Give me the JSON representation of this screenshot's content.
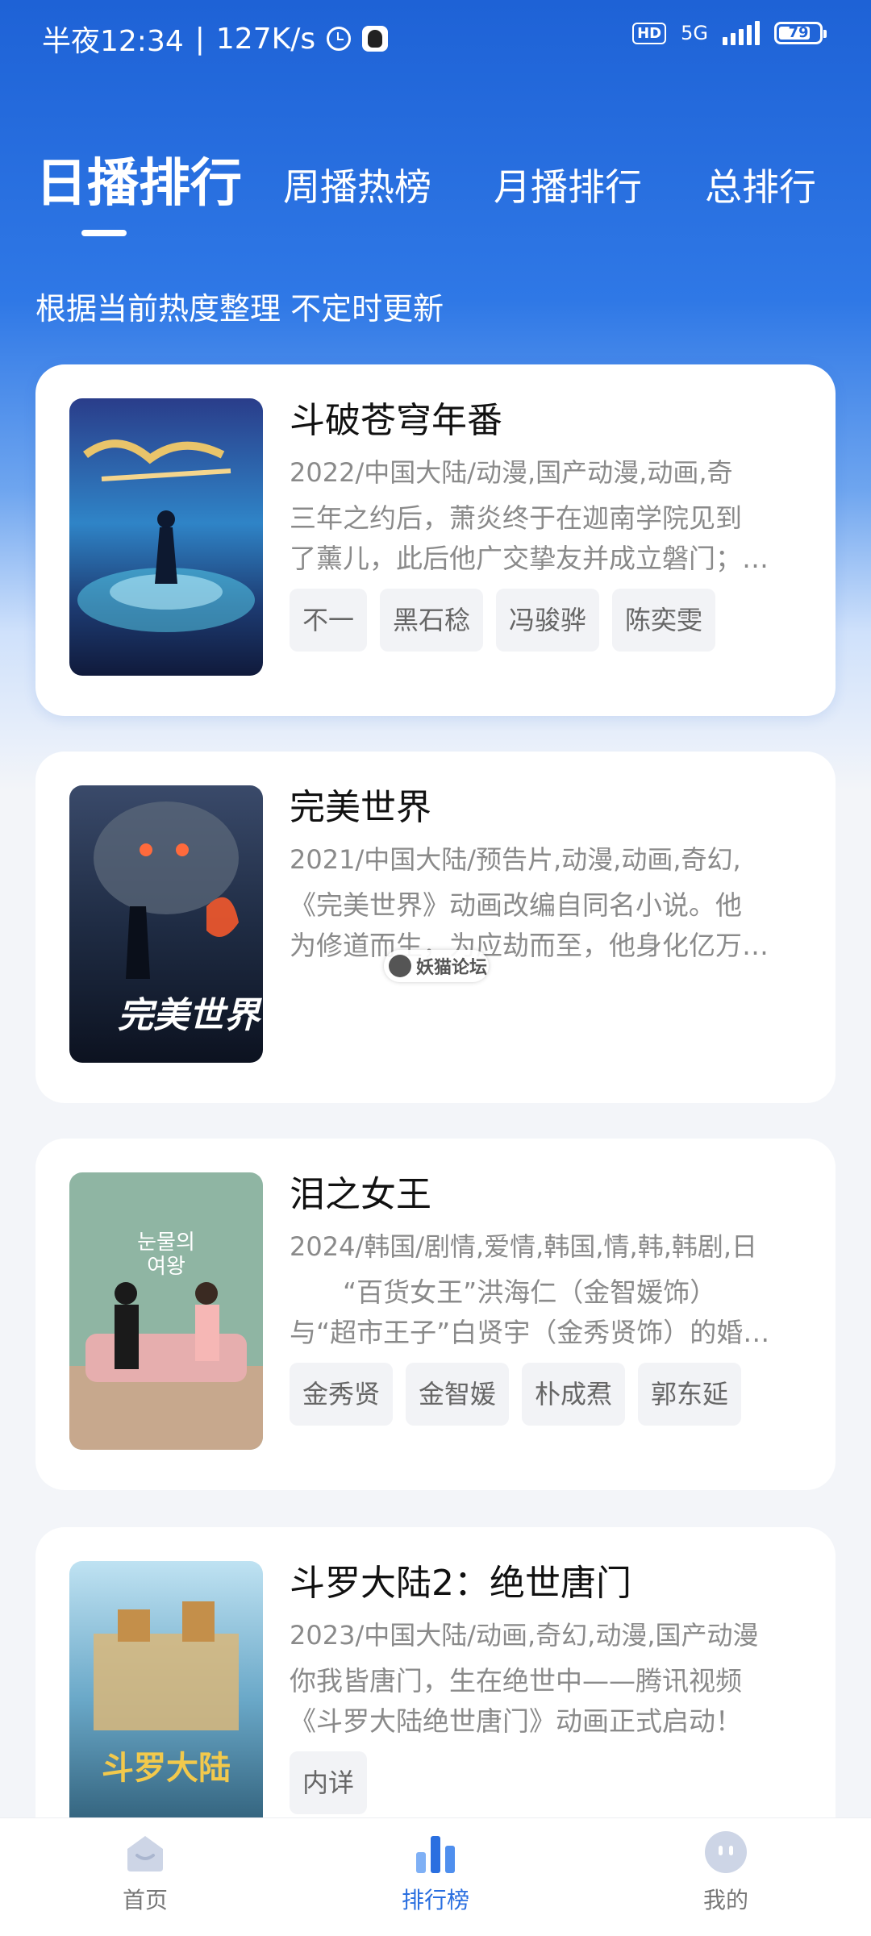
{
  "status_bar": {
    "time": "半夜12:34",
    "speed": "127K/s",
    "network": "5G",
    "hd": "HD",
    "battery": "79"
  },
  "tabs": [
    {
      "label": "日播排行",
      "active": true
    },
    {
      "label": "周播热榜",
      "active": false
    },
    {
      "label": "月播排行",
      "active": false
    },
    {
      "label": "总排行",
      "active": false
    }
  ],
  "subtitle": "根据当前热度整理 不定时更新",
  "items": [
    {
      "title": "斗破苍穹年番",
      "meta": "2022/中国大陆/动漫,国产动漫,动画,奇",
      "desc": [
        "三年之约后，萧炎终于在迦南学院见到",
        "了薰儿，此后他广交挚友并成立磐门；…"
      ],
      "tags": [
        "不一",
        "黑石稔",
        "冯骏骅",
        "陈奕雯"
      ]
    },
    {
      "title": "完美世界",
      "meta": "2021/中国大陆/预告片,动漫,动画,奇幻,",
      "desc": [
        "《完美世界》动画改编自同名小说。他",
        "为修道而生，为应劫而至，他身化亿万…"
      ],
      "tags": []
    },
    {
      "title": "泪之女王",
      "meta": "2024/韩国/剧情,爱情,韩国,情,韩,韩剧,日",
      "desc": [
        "　　“百货女王”洪海仁（金智媛饰）",
        "与“超市王子”白贤宇（金秀贤饰）的婚…"
      ],
      "tags": [
        "金秀贤",
        "金智媛",
        "朴成焄",
        "郭东延"
      ]
    },
    {
      "title": "斗罗大陆2：绝世唐门",
      "meta": "2023/中国大陆/动画,奇幻,动漫,国产动漫",
      "desc": [
        "你我皆唐门，生在绝世中——腾讯视频",
        "《斗罗大陆绝世唐门》动画正式启动！"
      ],
      "tags": [
        "内详"
      ]
    }
  ],
  "watermark": "妖猫论坛",
  "nav": [
    {
      "label": "首页",
      "icon": "home-icon",
      "active": false
    },
    {
      "label": "排行榜",
      "icon": "ranking-icon",
      "active": true
    },
    {
      "label": "我的",
      "icon": "profile-icon",
      "active": false
    }
  ],
  "colors": {
    "accent": "#2a6fe0",
    "hero": "#1e62d6"
  }
}
